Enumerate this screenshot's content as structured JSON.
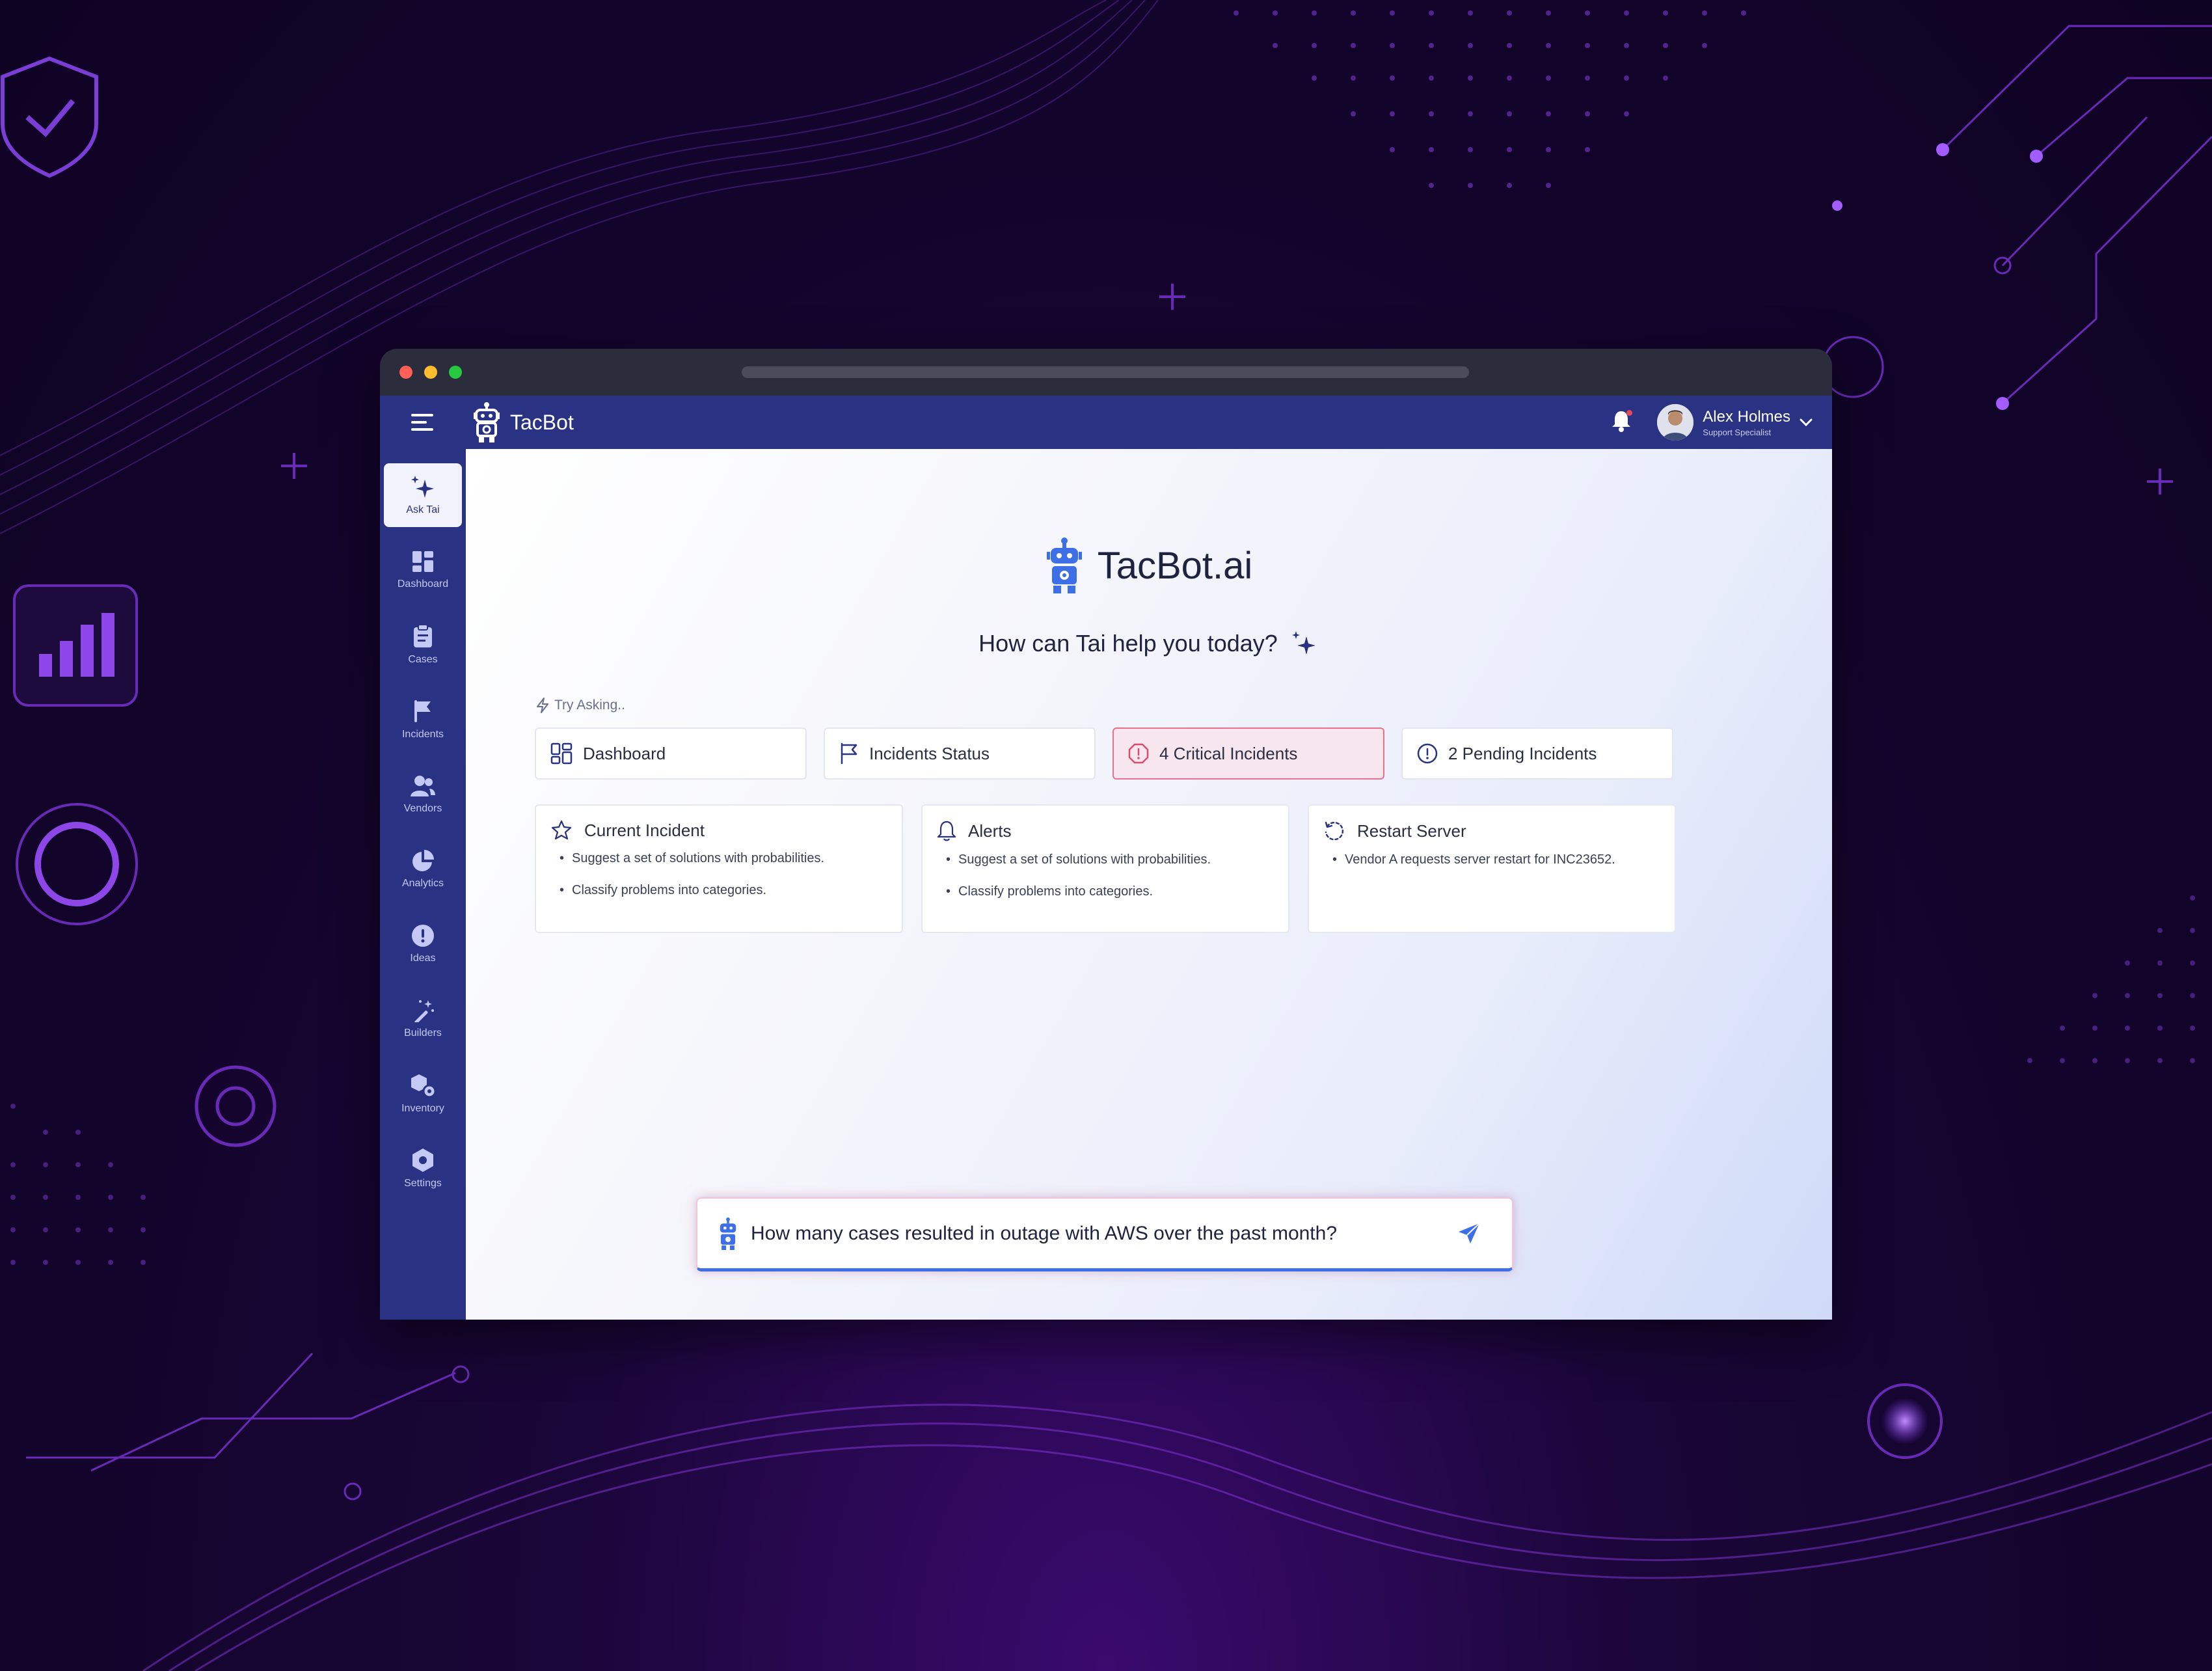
{
  "app": {
    "brand": "TacBot"
  },
  "header": {
    "user_name": "Alex Holmes",
    "user_role": "Support Specialist"
  },
  "sidebar": {
    "items": [
      {
        "label": "Ask Tai",
        "icon": "sparkle-icon",
        "active": true
      },
      {
        "label": "Dashboard",
        "icon": "dashboard-icon"
      },
      {
        "label": "Cases",
        "icon": "clipboard-icon"
      },
      {
        "label": "Incidents",
        "icon": "flag-icon"
      },
      {
        "label": "Vendors",
        "icon": "users-icon"
      },
      {
        "label": "Analytics",
        "icon": "pie-chart-icon"
      },
      {
        "label": "Ideas",
        "icon": "exclamation-icon"
      },
      {
        "label": "Builders",
        "icon": "magic-wand-icon"
      },
      {
        "label": "Inventory",
        "icon": "boxes-icon"
      },
      {
        "label": "Settings",
        "icon": "hexagon-gear-icon"
      }
    ]
  },
  "main": {
    "title": "TacBot.ai",
    "subtitle": "How can Tai help you today?",
    "try_label": "Try Asking..",
    "chips": [
      {
        "label": "Dashboard",
        "icon": "grid-icon"
      },
      {
        "label": "Incidents Status",
        "icon": "flag-icon"
      },
      {
        "label": "4 Critical Incidents",
        "icon": "alert-octagon-icon",
        "accent": "#e7728f"
      },
      {
        "label": "2 Pending Incidents",
        "icon": "alert-circle-icon"
      }
    ],
    "cards": [
      {
        "title": "Current Incident",
        "icon": "star-badge-icon",
        "bullets": [
          "Suggest a set of solutions with probabilities.",
          "Classify problems into categories."
        ]
      },
      {
        "title": "Alerts",
        "icon": "bell-icon",
        "bullets": [
          "Suggest a set of solutions with probabilities.",
          "Classify problems into categories."
        ]
      },
      {
        "title": "Restart Server",
        "icon": "refresh-icon",
        "bullets": [
          "Vendor A requests server restart for INC23652."
        ]
      }
    ]
  },
  "ask": {
    "value": "How many cases resulted in outage with AWS over the past month?"
  },
  "colors": {
    "appbar": "#2a3283",
    "accent_blue": "#3d6fe6",
    "critical": "#e7728f",
    "background": "#12042a"
  }
}
